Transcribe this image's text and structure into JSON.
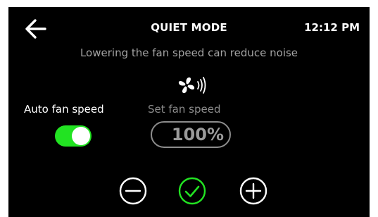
{
  "header": {
    "title": "QUIET MODE",
    "time": "12:12 PM"
  },
  "subtitle": "Lowering the fan speed can reduce noise",
  "auto_fan": {
    "label": "Auto fan speed",
    "enabled": true
  },
  "set_fan": {
    "label": "Set fan speed",
    "value": "100%"
  },
  "icons": {
    "back": "arrow-left-icon",
    "fan": "fan-sound-icon",
    "decrease": "minus-circle-icon",
    "confirm": "check-circle-icon",
    "increase": "plus-circle-icon"
  },
  "colors": {
    "accent": "#22e322",
    "background": "#000000",
    "muted_text": "#a3a3a3",
    "disabled": "#8c8c8c"
  }
}
